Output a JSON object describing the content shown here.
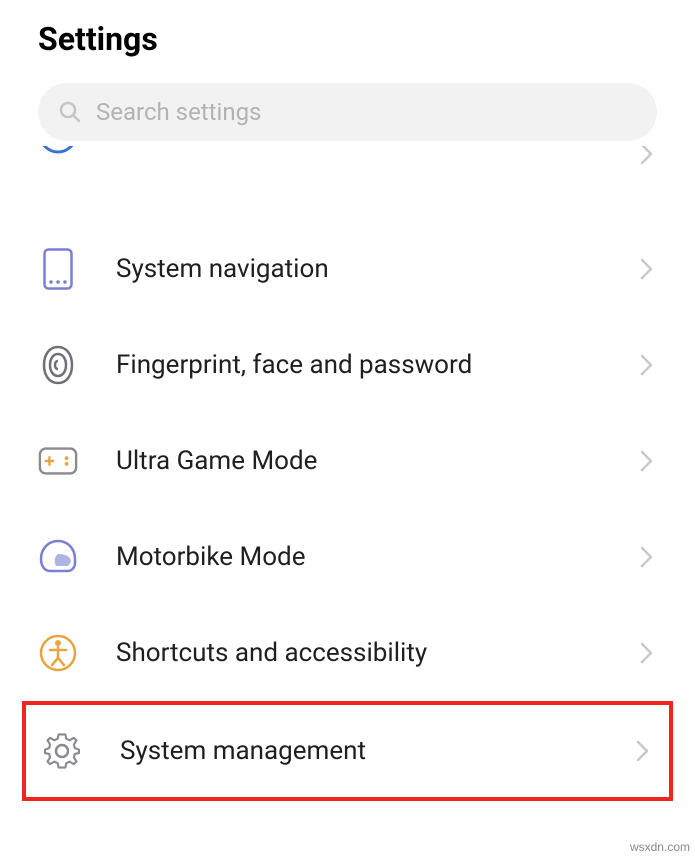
{
  "header": {
    "title": "Settings"
  },
  "search": {
    "placeholder": "Search settings"
  },
  "items": [
    {
      "label": "System navigation"
    },
    {
      "label": "Fingerprint, face and password"
    },
    {
      "label": "Ultra Game Mode"
    },
    {
      "label": "Motorbike Mode"
    },
    {
      "label": "Shortcuts and accessibility"
    },
    {
      "label": "System management"
    }
  ],
  "watermark": "wsxdn.com"
}
